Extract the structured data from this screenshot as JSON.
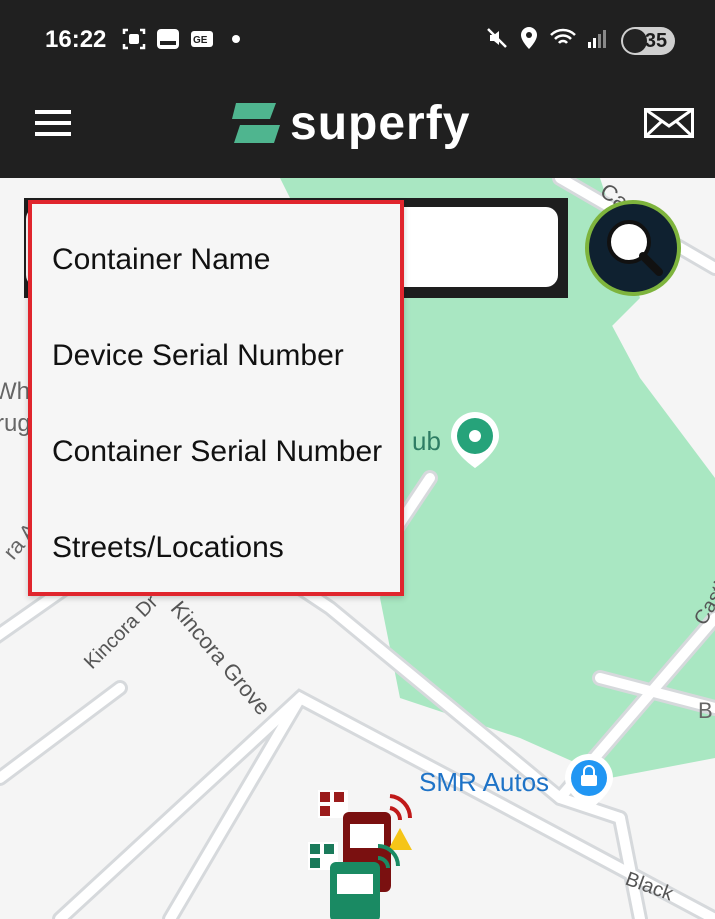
{
  "status": {
    "time": "16:22",
    "battery": "35"
  },
  "app": {
    "title": "superfy"
  },
  "search_options": [
    "Container Name",
    "Device Serial Number",
    "Container Serial Number",
    "Streets/Locations"
  ],
  "map_labels": {
    "pub_partial": "ub",
    "auto_shop": "SMR Autos",
    "street_1": "Kincora Dr",
    "street_2": "Kincora Grove",
    "street_3": "Castle G",
    "street_4": "Castl",
    "street_5": "Black",
    "partial_left_1": "Whe",
    "partial_left_2": "rug",
    "partial_left_3": "ra A",
    "partial_right_1": "B"
  },
  "colors": {
    "accent_red": "#e0252d",
    "brand_green": "#4fb58f",
    "park_green": "#a9e7c2"
  }
}
